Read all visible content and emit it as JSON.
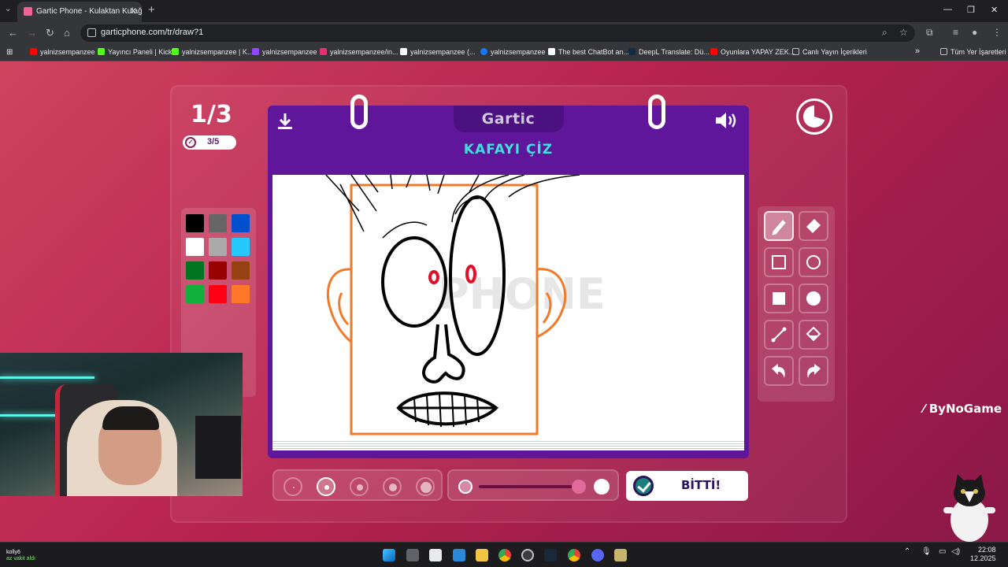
{
  "browser": {
    "tab_title": "Gartic Phone - Kulaktan Kulağa",
    "tab_close": "✕",
    "new_tab": "+",
    "url": "garticphone.com/tr/draw?1",
    "window_controls": [
      "—",
      "❐",
      "✕"
    ]
  },
  "bookmarks": {
    "items": [
      {
        "label": "yalnizsempanzee",
        "color": "#ff0000"
      },
      {
        "label": "Yayıncı Paneli | Kick",
        "color": "#53fc18"
      },
      {
        "label": "yalnizsempanzee | K...",
        "color": "#53fc18"
      },
      {
        "label": "yalnizsempanzee",
        "color": "#9146ff"
      },
      {
        "label": "yalnizsempanzee/in...",
        "color": "#e1306c"
      },
      {
        "label": "yalnizsempanzee (...",
        "color": "#ffffff"
      },
      {
        "label": "yalnizsempanzee",
        "color": "#1877f2"
      },
      {
        "label": "The best ChatBot an...",
        "color": "#ffffff"
      },
      {
        "label": "DeepL Translate: Dü...",
        "color": "#0f2b46"
      },
      {
        "label": "Oyunlara YAPAY ZEK...",
        "color": "#ff0000"
      },
      {
        "label": "Canlı Yayın İçerikleri",
        "color": "#bdc1c6"
      }
    ],
    "overflow": "»",
    "all_bookmarks": "Tüm Yer İşaretleri"
  },
  "game": {
    "round": "1/3",
    "players_done": "3/5",
    "logo": "Gartic",
    "prompt": "KAFAYI ÇİZ",
    "done_button": "BİTTİ!",
    "brand": "ByNoGame",
    "accent": "#5f169b",
    "prompt_color": "#3ee0dc",
    "colors": [
      "#000000",
      "#666666",
      "#0050cd",
      "#ffffff",
      "#aaaaaa",
      "#26c9ff",
      "#017420",
      "#990000",
      "#964112",
      "#11b03c",
      "#ff0013",
      "#ff7829"
    ],
    "tools": [
      "pencil-icon",
      "eraser-icon",
      "rectangle-outline-icon",
      "ellipse-outline-icon",
      "rectangle-fill-icon",
      "ellipse-fill-icon",
      "line-icon",
      "fill-bucket-icon",
      "undo-icon",
      "redo-icon"
    ],
    "brush_sizes_selected_index": 1
  },
  "taskbar": {
    "time": "22:08",
    "date": "12.2025",
    "user": "kolly6",
    "user_status": "az vakit aldı"
  }
}
